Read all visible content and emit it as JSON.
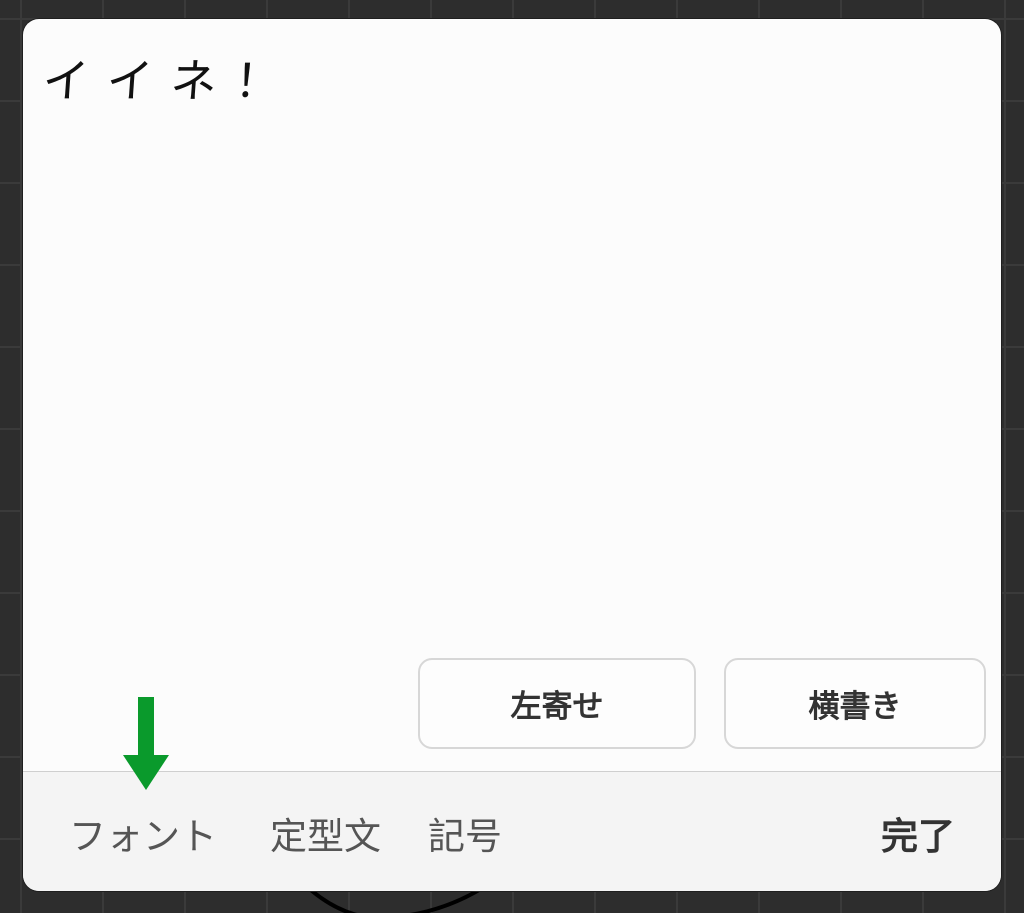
{
  "editor": {
    "text": "イイネ！"
  },
  "options": {
    "align_label": "左寄せ",
    "orientation_label": "横書き"
  },
  "toolbar": {
    "font_label": "フォント",
    "phrase_label": "定型文",
    "symbol_label": "記号",
    "done_label": "完了"
  },
  "annotation": {
    "arrow_icon": "green-down-arrow",
    "arrow_color": "#0a9a2c"
  },
  "colors": {
    "background": "#2d2d2d",
    "panel": "#fcfcfc",
    "toolbar": "#f4f4f4",
    "text": "#111111"
  }
}
